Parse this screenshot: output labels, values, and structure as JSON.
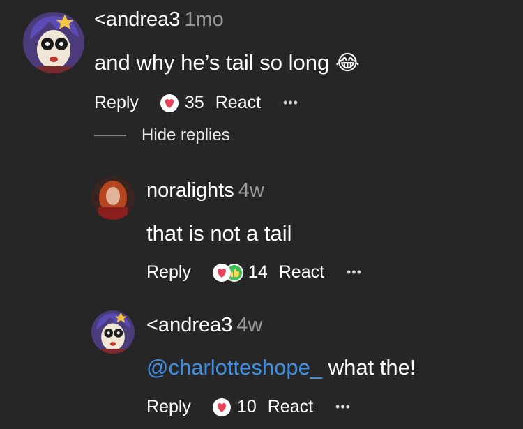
{
  "comments": [
    {
      "username": "<andrea3",
      "time": "1mo",
      "text": "and why he’s tail so long",
      "emoji": "😂",
      "actions": {
        "reply": "Reply",
        "count": "35",
        "react": "React",
        "more": "•••"
      },
      "avatar_icon": "cartoon-avatar-icon",
      "reaction_icon": "heart-face-icon"
    },
    {
      "username": "noralights",
      "time": "4w",
      "text": "that is not a tail",
      "actions": {
        "reply": "Reply",
        "count": "14",
        "react": "React",
        "more": "•••"
      },
      "avatar_icon": "photo-avatar-icon",
      "reaction_icon": "heart-thumbsup-icon"
    },
    {
      "username": "<andrea3",
      "time": "4w",
      "mention": "@charlotteshope_",
      "text": " what the!",
      "actions": {
        "reply": "Reply",
        "count": "10",
        "react": "React",
        "more": "•••"
      },
      "avatar_icon": "cartoon-avatar-icon",
      "reaction_icon": "heart-face-icon"
    }
  ],
  "hide_replies": "Hide replies",
  "colors": {
    "background": "#262626",
    "mention": "#3f8fe6",
    "heart": "#e8455a",
    "thumbs": "#3fbf5a"
  }
}
